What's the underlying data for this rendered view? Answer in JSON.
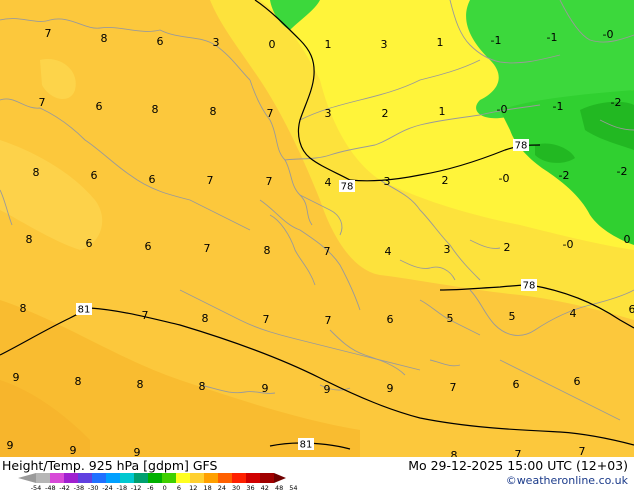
{
  "header": {
    "title": "Height/Temp. 925 hPa [gdpm] GFS",
    "datetime": "Mo 29-12-2025 15:00 UTC (12+03)",
    "credit": "©weatheronline.co.uk"
  },
  "legend": {
    "ticks": [
      "-54",
      "-48",
      "-42",
      "-38",
      "-30",
      "-24",
      "-18",
      "-12",
      "-6",
      "0",
      "6",
      "12",
      "18",
      "24",
      "30",
      "36",
      "42",
      "48",
      "54"
    ],
    "colors": [
      "#9a9a9a",
      "#b6b6b6",
      "#d84ad8",
      "#a020d0",
      "#6040e0",
      "#2070ff",
      "#00a0ff",
      "#00c8d0",
      "#00a070",
      "#00b000",
      "#40d000",
      "#ffff20",
      "#ffd030",
      "#ffa000",
      "#ff6000",
      "#ff2000",
      "#d00000",
      "#a00000",
      "#700000"
    ]
  },
  "map": {
    "contour_labels": [
      "78",
      "78",
      "78",
      "81",
      "81"
    ],
    "temperature_labels": [
      "7",
      "8",
      "6",
      "3",
      "0",
      "1",
      "3",
      "1",
      "-1",
      "-1",
      "-0",
      "7",
      "6",
      "8",
      "8",
      "7",
      "3",
      "2",
      "1",
      "-0",
      "-1",
      "-2",
      "8",
      "6",
      "6",
      "7",
      "7",
      "4",
      "3",
      "2",
      "-0",
      "-2",
      "-2",
      "8",
      "6",
      "6",
      "7",
      "8",
      "7",
      "4",
      "3",
      "2",
      "-0",
      "0",
      "8",
      "7",
      "8",
      "7",
      "7",
      "6",
      "5",
      "5",
      "4",
      "6",
      "9",
      "8",
      "8",
      "8",
      "9",
      "9",
      "9",
      "7",
      "6",
      "6",
      "9",
      "9",
      "9",
      "8",
      "7",
      "7"
    ]
  }
}
